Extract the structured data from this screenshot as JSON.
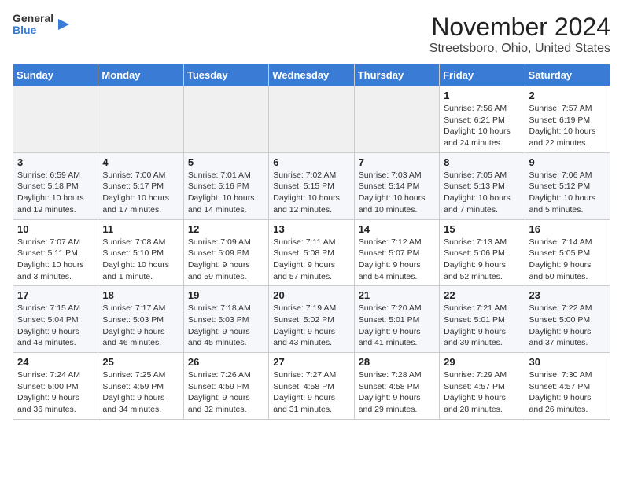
{
  "header": {
    "logo": {
      "general": "General",
      "blue": "Blue"
    },
    "title": "November 2024",
    "location": "Streetsboro, Ohio, United States"
  },
  "weekdays": [
    "Sunday",
    "Monday",
    "Tuesday",
    "Wednesday",
    "Thursday",
    "Friday",
    "Saturday"
  ],
  "weeks": [
    [
      {
        "day": "",
        "info": ""
      },
      {
        "day": "",
        "info": ""
      },
      {
        "day": "",
        "info": ""
      },
      {
        "day": "",
        "info": ""
      },
      {
        "day": "",
        "info": ""
      },
      {
        "day": "1",
        "info": "Sunrise: 7:56 AM\nSunset: 6:21 PM\nDaylight: 10 hours and 24 minutes."
      },
      {
        "day": "2",
        "info": "Sunrise: 7:57 AM\nSunset: 6:19 PM\nDaylight: 10 hours and 22 minutes."
      }
    ],
    [
      {
        "day": "3",
        "info": "Sunrise: 6:59 AM\nSunset: 5:18 PM\nDaylight: 10 hours and 19 minutes."
      },
      {
        "day": "4",
        "info": "Sunrise: 7:00 AM\nSunset: 5:17 PM\nDaylight: 10 hours and 17 minutes."
      },
      {
        "day": "5",
        "info": "Sunrise: 7:01 AM\nSunset: 5:16 PM\nDaylight: 10 hours and 14 minutes."
      },
      {
        "day": "6",
        "info": "Sunrise: 7:02 AM\nSunset: 5:15 PM\nDaylight: 10 hours and 12 minutes."
      },
      {
        "day": "7",
        "info": "Sunrise: 7:03 AM\nSunset: 5:14 PM\nDaylight: 10 hours and 10 minutes."
      },
      {
        "day": "8",
        "info": "Sunrise: 7:05 AM\nSunset: 5:13 PM\nDaylight: 10 hours and 7 minutes."
      },
      {
        "day": "9",
        "info": "Sunrise: 7:06 AM\nSunset: 5:12 PM\nDaylight: 10 hours and 5 minutes."
      }
    ],
    [
      {
        "day": "10",
        "info": "Sunrise: 7:07 AM\nSunset: 5:11 PM\nDaylight: 10 hours and 3 minutes."
      },
      {
        "day": "11",
        "info": "Sunrise: 7:08 AM\nSunset: 5:10 PM\nDaylight: 10 hours and 1 minute."
      },
      {
        "day": "12",
        "info": "Sunrise: 7:09 AM\nSunset: 5:09 PM\nDaylight: 9 hours and 59 minutes."
      },
      {
        "day": "13",
        "info": "Sunrise: 7:11 AM\nSunset: 5:08 PM\nDaylight: 9 hours and 57 minutes."
      },
      {
        "day": "14",
        "info": "Sunrise: 7:12 AM\nSunset: 5:07 PM\nDaylight: 9 hours and 54 minutes."
      },
      {
        "day": "15",
        "info": "Sunrise: 7:13 AM\nSunset: 5:06 PM\nDaylight: 9 hours and 52 minutes."
      },
      {
        "day": "16",
        "info": "Sunrise: 7:14 AM\nSunset: 5:05 PM\nDaylight: 9 hours and 50 minutes."
      }
    ],
    [
      {
        "day": "17",
        "info": "Sunrise: 7:15 AM\nSunset: 5:04 PM\nDaylight: 9 hours and 48 minutes."
      },
      {
        "day": "18",
        "info": "Sunrise: 7:17 AM\nSunset: 5:03 PM\nDaylight: 9 hours and 46 minutes."
      },
      {
        "day": "19",
        "info": "Sunrise: 7:18 AM\nSunset: 5:03 PM\nDaylight: 9 hours and 45 minutes."
      },
      {
        "day": "20",
        "info": "Sunrise: 7:19 AM\nSunset: 5:02 PM\nDaylight: 9 hours and 43 minutes."
      },
      {
        "day": "21",
        "info": "Sunrise: 7:20 AM\nSunset: 5:01 PM\nDaylight: 9 hours and 41 minutes."
      },
      {
        "day": "22",
        "info": "Sunrise: 7:21 AM\nSunset: 5:01 PM\nDaylight: 9 hours and 39 minutes."
      },
      {
        "day": "23",
        "info": "Sunrise: 7:22 AM\nSunset: 5:00 PM\nDaylight: 9 hours and 37 minutes."
      }
    ],
    [
      {
        "day": "24",
        "info": "Sunrise: 7:24 AM\nSunset: 5:00 PM\nDaylight: 9 hours and 36 minutes."
      },
      {
        "day": "25",
        "info": "Sunrise: 7:25 AM\nSunset: 4:59 PM\nDaylight: 9 hours and 34 minutes."
      },
      {
        "day": "26",
        "info": "Sunrise: 7:26 AM\nSunset: 4:59 PM\nDaylight: 9 hours and 32 minutes."
      },
      {
        "day": "27",
        "info": "Sunrise: 7:27 AM\nSunset: 4:58 PM\nDaylight: 9 hours and 31 minutes."
      },
      {
        "day": "28",
        "info": "Sunrise: 7:28 AM\nSunset: 4:58 PM\nDaylight: 9 hours and 29 minutes."
      },
      {
        "day": "29",
        "info": "Sunrise: 7:29 AM\nSunset: 4:57 PM\nDaylight: 9 hours and 28 minutes."
      },
      {
        "day": "30",
        "info": "Sunrise: 7:30 AM\nSunset: 4:57 PM\nDaylight: 9 hours and 26 minutes."
      }
    ]
  ]
}
